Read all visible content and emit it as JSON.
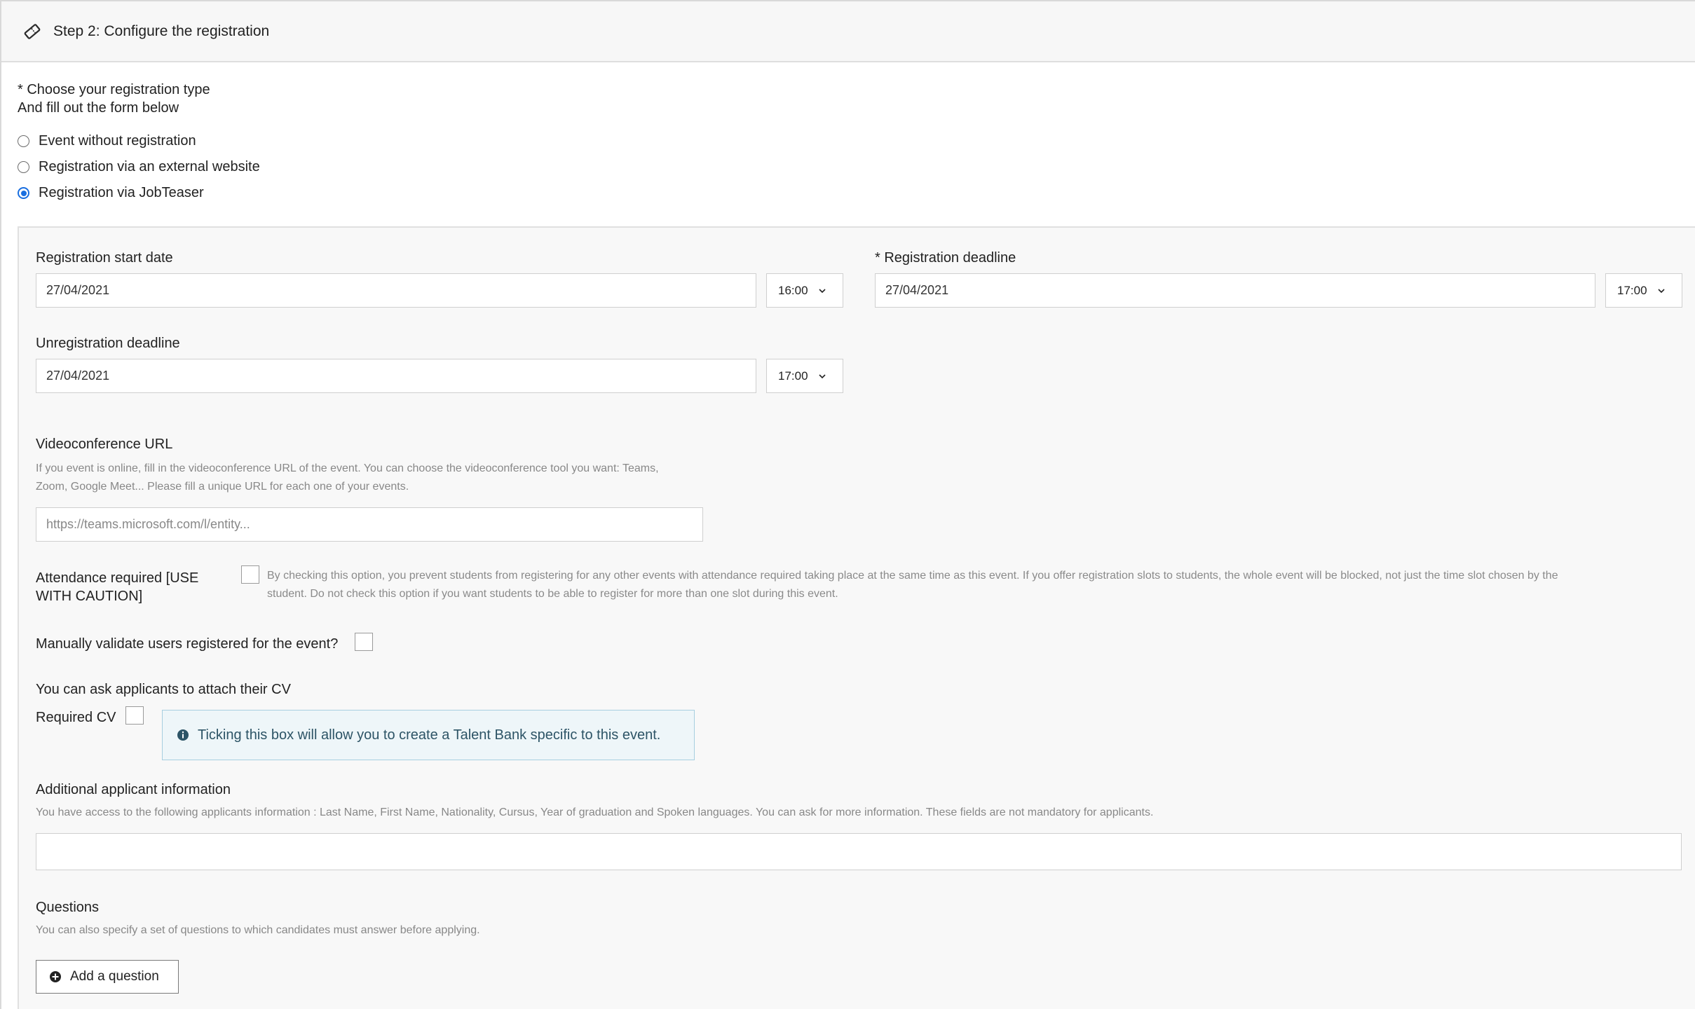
{
  "header": {
    "icon": "ticket-icon",
    "title": "Step 2: Configure the registration"
  },
  "registration_type": {
    "prompt": "* Choose your registration type",
    "subprompt": "And fill out the form below",
    "options": [
      {
        "label": "Event without registration",
        "selected": false
      },
      {
        "label": "Registration via an external website",
        "selected": false
      },
      {
        "label": "Registration via JobTeaser",
        "selected": true
      }
    ]
  },
  "form": {
    "start": {
      "label": "Registration start date",
      "date": "27/04/2021",
      "time": "16:00"
    },
    "deadline": {
      "label": "* Registration deadline",
      "date": "27/04/2021",
      "time": "17:00"
    },
    "unregistration": {
      "label": "Unregistration deadline",
      "date": "27/04/2021",
      "time": "17:00"
    },
    "videoconference": {
      "label": "Videoconference URL",
      "help_line1": "If you event is online, fill in the videoconference URL of the event. You can choose the videoconference tool you want: Teams,",
      "help_line2": "Zoom, Google Meet... Please fill a unique URL for each one of your events.",
      "placeholder": "https://teams.microsoft.com/l/entity..."
    },
    "attendance": {
      "label_line1": "Attendance required [USE",
      "label_line2": "WITH CAUTION]",
      "help_line1": "By checking this option, you prevent students from registering for any other events with attendance required taking place at the same time as this event. If you offer registration slots to students, the whole event will be blocked, not just the time slot chosen by the",
      "help_line2": "student. Do not check this option if you want students to be able to register for more than one slot during this event."
    },
    "manual_validation": {
      "label": "Manually validate users registered for the event?"
    },
    "cv": {
      "intro": "You can ask applicants to attach their CV",
      "label": "Required CV",
      "info": "Ticking this box will allow you to create a Talent Bank specific to this event."
    },
    "additional_info": {
      "label": "Additional applicant information",
      "help": "You have access to the following applicants information : Last Name, First Name, Nationality, Cursus, Year of graduation and Spoken languages. You can ask for more information. These fields are not mandatory for applicants."
    },
    "questions": {
      "label": "Questions",
      "help": "You can also specify a set of questions to which candidates must answer before applying.",
      "add_button": "Add a question"
    }
  }
}
